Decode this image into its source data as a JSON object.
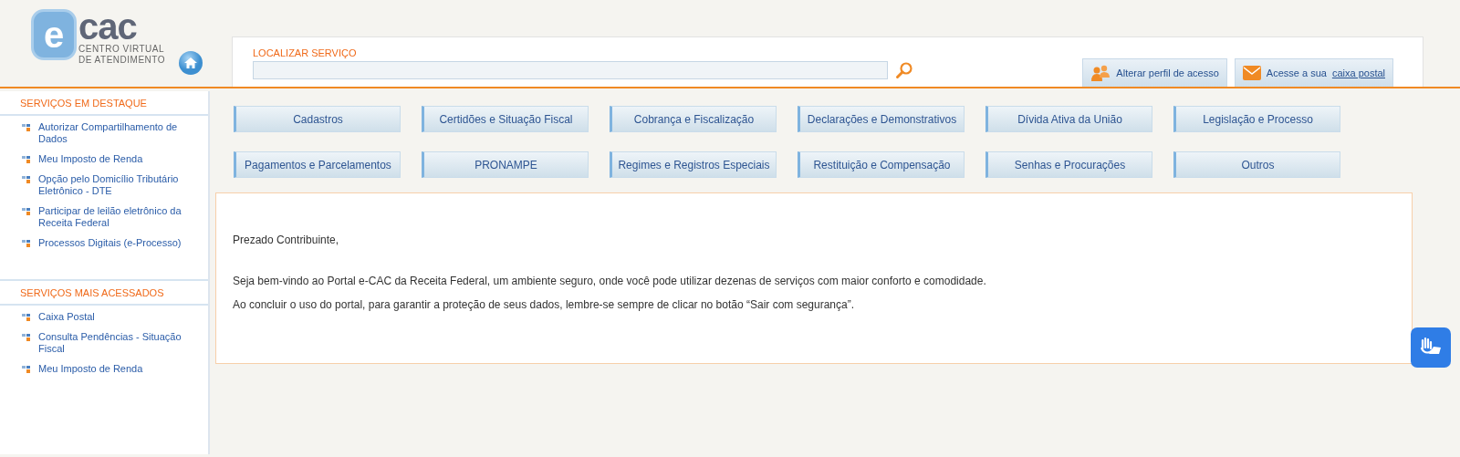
{
  "header": {
    "logo": {
      "letter": "e",
      "word": "cac",
      "tagline_1": "CENTRO VIRTUAL",
      "tagline_2": "DE ATENDIMENTO"
    },
    "search": {
      "label": "LOCALIZAR SERVIÇO"
    },
    "profile_button": {
      "label": "Alterar perfil de acesso"
    },
    "mailbox_button": {
      "label": "Acesse a sua",
      "link": "caixa postal"
    }
  },
  "sidebar": {
    "sections": [
      {
        "title": "SERVIÇOS EM DESTAQUE",
        "items": [
          "Autorizar Compartilhamento de Dados",
          "Meu Imposto de Renda",
          "Opção pelo Domicílio Tributário Eletrônico - DTE",
          "Participar de leilão eletrônico da Receita Federal",
          "Processos Digitais (e-Processo)"
        ]
      },
      {
        "title": "SERVIÇOS MAIS ACESSADOS",
        "items": [
          "Caixa Postal",
          "Consulta Pendências - Situação Fiscal",
          "Meu Imposto de Renda"
        ]
      }
    ]
  },
  "categories": [
    [
      "Cadastros",
      "Certidões e Situação Fiscal",
      "Cobrança e Fiscalização",
      "Declarações e Demonstrativos",
      "Dívida Ativa da União",
      "Legislação e Processo"
    ],
    [
      "Pagamentos e Parcelamentos",
      "PRONAMPE",
      "Regimes e Registros Especiais",
      "Restituição e Compensação",
      "Senhas e Procurações",
      "Outros"
    ]
  ],
  "welcome": {
    "greeting": "Prezado Contribuinte,",
    "paragraphs": [
      "Seja bem-vindo ao Portal e-CAC da Receita Federal, um ambiente seguro, onde você pode utilizar dezenas de serviços com maior conforto e comodidade.",
      "Ao concluir o uso do portal, para garantir a proteção de seus dados, lembre-se sempre de clicar no botão “Sair com segurança”."
    ]
  }
}
